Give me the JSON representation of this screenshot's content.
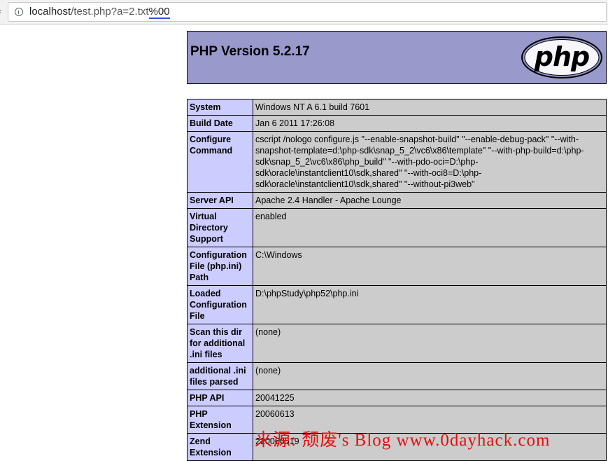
{
  "browser": {
    "url_prefix": "localhost",
    "url_path": "/test.php?a=2.txt",
    "url_encoded": "%00"
  },
  "header": {
    "title": "PHP Version 5.2.17",
    "logo_text": "php"
  },
  "table": {
    "rows": [
      {
        "key": "System",
        "value": "Windows NT A 6.1 build 7601"
      },
      {
        "key": "Build Date",
        "value": "Jan 6 2011 17:26:08"
      },
      {
        "key": "Configure Command",
        "value": "cscript /nologo configure.js \"--enable-snapshot-build\" \"--enable-debug-pack\" \"--with-snapshot-template=d:\\php-sdk\\snap_5_2\\vc6\\x86\\template\" \"--with-php-build=d:\\php-sdk\\snap_5_2\\vc6\\x86\\php_build\" \"--with-pdo-oci=D:\\php-sdk\\oracle\\instantclient10\\sdk,shared\" \"--with-oci8=D:\\php-sdk\\oracle\\instantclient10\\sdk,shared\" \"--without-pi3web\""
      },
      {
        "key": "Server API",
        "value": "Apache 2.4 Handler - Apache Lounge"
      },
      {
        "key": "Virtual Directory Support",
        "value": "enabled"
      },
      {
        "key": "Configuration File (php.ini) Path",
        "value": "C:\\Windows"
      },
      {
        "key": "Loaded Configuration File",
        "value": "D:\\phpStudy\\php52\\php.ini"
      },
      {
        "key": "Scan this dir for additional .ini files",
        "value": "(none)"
      },
      {
        "key": "additional .ini files parsed",
        "value": "(none)"
      },
      {
        "key": "PHP API",
        "value": "20041225"
      },
      {
        "key": "PHP Extension",
        "value": "20060613"
      },
      {
        "key": "Zend Extension",
        "value": "220060519"
      }
    ]
  },
  "watermark": {
    "text": "来源: 颓废's Blog www.0dayhack.com"
  },
  "colors": {
    "header_bg": "#9999cc",
    "key_bg": "#ccccff",
    "value_bg": "#cccccc",
    "watermark": "#e0110f"
  }
}
